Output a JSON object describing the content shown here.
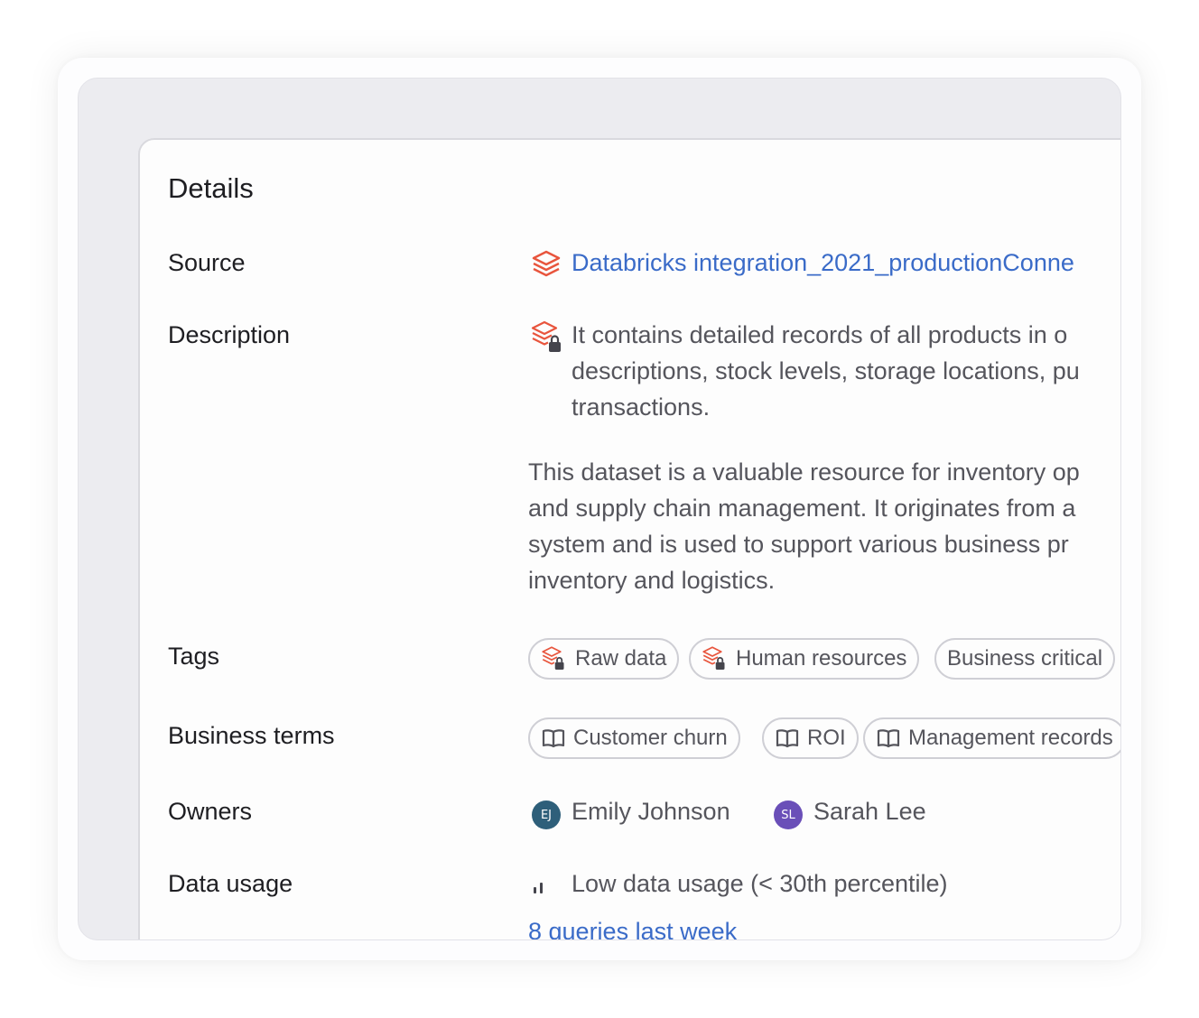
{
  "details": {
    "title": "Details",
    "source": {
      "label": "Source",
      "icon": "databricks-icon",
      "value": "Databricks integration_2021_productionConne"
    },
    "description": {
      "label": "Description",
      "icon": "databricks-locked-icon",
      "line1": "It contains detailed records of all products in o",
      "line2": "descriptions, stock levels, storage locations, pu",
      "line3": "transactions.",
      "para2_line1": "This dataset is a valuable resource for inventory op",
      "para2_line2": "and supply chain management. It originates from a",
      "para2_line3": "system and is used to support various business pr",
      "para2_line4": "inventory and logistics."
    },
    "tags": {
      "label": "Tags",
      "items": [
        {
          "label": "Raw data",
          "icon": "databricks-locked-icon"
        },
        {
          "label": "Human resources",
          "icon": "databricks-locked-icon"
        },
        {
          "label": "Business critical"
        }
      ]
    },
    "business_terms": {
      "label": "Business terms",
      "items": [
        {
          "label": "Customer churn",
          "icon": "book-icon"
        },
        {
          "label": "ROI",
          "icon": "book-icon"
        },
        {
          "label": "Management records",
          "icon": "book-icon"
        }
      ]
    },
    "owners": {
      "label": "Owners",
      "items": [
        {
          "initials": "EJ",
          "name": "Emily Johnson",
          "color": "#2e5f7a"
        },
        {
          "initials": "SL",
          "name": "Sarah Lee",
          "color": "#6a4fb8"
        }
      ]
    },
    "data_usage": {
      "label": "Data usage",
      "icon": "usage-bars-icon",
      "value": "Low data usage (< 30th percentile)",
      "queries": "8 queries last week"
    }
  },
  "colors": {
    "accent_link": "#3a6bc8",
    "databricks_orange": "#e8553d"
  }
}
